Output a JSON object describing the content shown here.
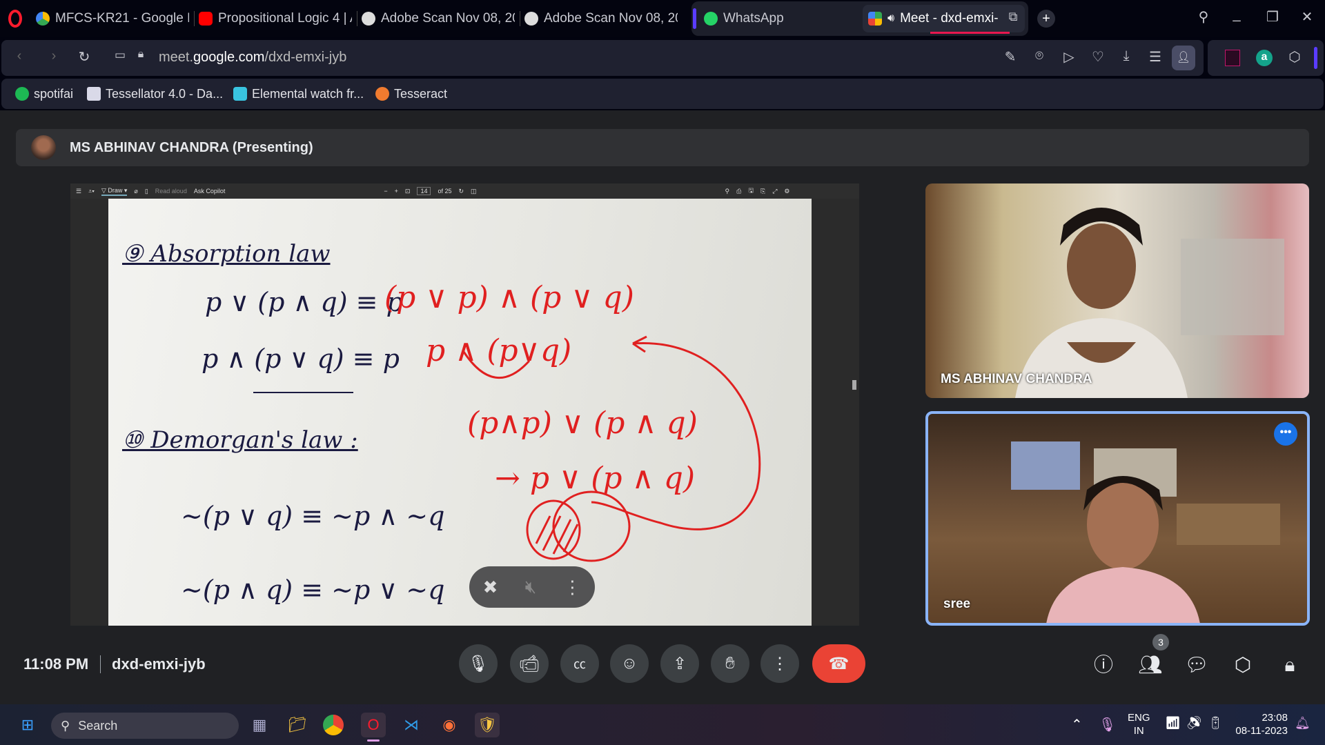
{
  "browser": {
    "tabs": [
      {
        "label": "MFCS-KR21 - Google Dr",
        "icon": "google-drive-icon"
      },
      {
        "label": "Propositional Logic 4 | A",
        "icon": "youtube-icon"
      },
      {
        "label": "Adobe Scan Nov 08, 202",
        "icon": "globe-icon"
      },
      {
        "label": "Adobe Scan Nov 08, 202",
        "icon": "globe-icon"
      },
      {
        "label": "WhatsApp",
        "icon": "whatsapp-icon"
      },
      {
        "label": "Meet - dxd-emxi-",
        "icon": "google-meet-icon",
        "active": true
      }
    ],
    "url_prefix": "meet.",
    "url_domain": "google.com",
    "url_path": "/dxd-emxi-jyb",
    "bookmarks": [
      {
        "label": "spotifai",
        "color": "#1db954"
      },
      {
        "label": "Tessellator 4.0 - Da...",
        "color": "#d9d9e8"
      },
      {
        "label": "Elemental watch fr...",
        "color": "#39c4e0"
      },
      {
        "label": "Tesseract",
        "color": "#f07b2f"
      }
    ],
    "accent": "#e8174f"
  },
  "meet": {
    "presenter_banner": "MS ABHINAV CHANDRA (Presenting)",
    "pdf_toolbar": {
      "draw": "Draw",
      "read_aloud": "Read aloud",
      "ask_copilot": "Ask Copilot",
      "page": "14",
      "of_pages": "of 25"
    },
    "whiteboard": {
      "h1": "⑨ Absorption law",
      "l1": "p ∨ (p ∧ q) ≡ p",
      "l2": "p ∧ (p ∨ q) ≡ p",
      "h2": "⑩ Demorgan's law :",
      "l3": "∼(p ∨ q) ≡ ∼p ∧ ∼q",
      "l4": "∼(p ∧ q) ≡ ∼p ∨ ∼q",
      "r1": "(p ∨ p) ∧ (p ∨ q)",
      "r2": "p ∧ (p∨q)",
      "r3": "(p∧p) ∨ (p ∧ q)",
      "r4": "→ p ∨ (p ∧ q)"
    },
    "participants": [
      {
        "name": "MS ABHINAV CHANDRA"
      },
      {
        "name": "sree",
        "speaking": true
      }
    ],
    "time": "11:08 PM",
    "meeting_code": "dxd-emxi-jyb",
    "people_count": "3"
  },
  "taskbar": {
    "search": "Search",
    "lang1": "ENG",
    "lang2": "IN",
    "time": "23:08",
    "date": "08-11-2023"
  }
}
